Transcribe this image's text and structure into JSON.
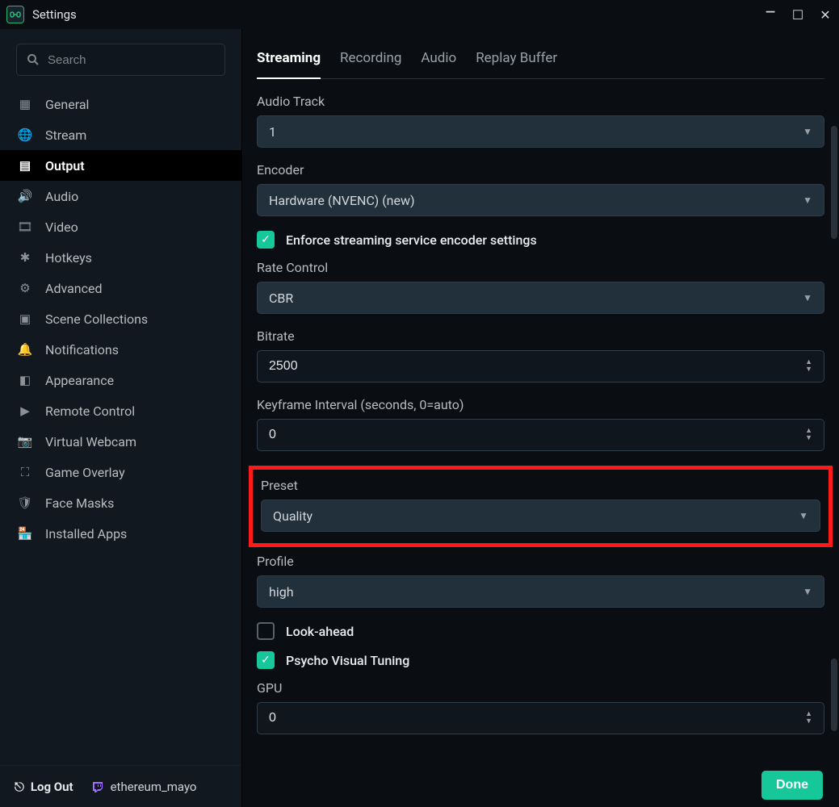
{
  "window": {
    "title": "Settings"
  },
  "search": {
    "placeholder": "Search"
  },
  "sidebar": {
    "items": [
      {
        "label": "General"
      },
      {
        "label": "Stream"
      },
      {
        "label": "Output"
      },
      {
        "label": "Audio"
      },
      {
        "label": "Video"
      },
      {
        "label": "Hotkeys"
      },
      {
        "label": "Advanced"
      },
      {
        "label": "Scene Collections"
      },
      {
        "label": "Notifications"
      },
      {
        "label": "Appearance"
      },
      {
        "label": "Remote Control"
      },
      {
        "label": "Virtual Webcam"
      },
      {
        "label": "Game Overlay"
      },
      {
        "label": "Face Masks"
      },
      {
        "label": "Installed Apps"
      }
    ],
    "logout": "Log Out",
    "username": "ethereum_mayo"
  },
  "tabs": [
    {
      "label": "Streaming",
      "active": true
    },
    {
      "label": "Recording"
    },
    {
      "label": "Audio"
    },
    {
      "label": "Replay Buffer"
    }
  ],
  "form": {
    "audio_track_label": "Audio Track",
    "audio_track_value": "1",
    "encoder_label": "Encoder",
    "encoder_value": "Hardware (NVENC) (new)",
    "enforce_label": "Enforce streaming service encoder settings",
    "rate_control_label": "Rate Control",
    "rate_control_value": "CBR",
    "bitrate_label": "Bitrate",
    "bitrate_value": "2500",
    "keyframe_label": "Keyframe Interval (seconds, 0=auto)",
    "keyframe_value": "0",
    "preset_label": "Preset",
    "preset_value": "Quality",
    "profile_label": "Profile",
    "profile_value": "high",
    "lookahead_label": "Look-ahead",
    "psycho_label": "Psycho Visual Tuning",
    "gpu_label": "GPU",
    "gpu_value": "0"
  },
  "footer": {
    "done": "Done"
  }
}
